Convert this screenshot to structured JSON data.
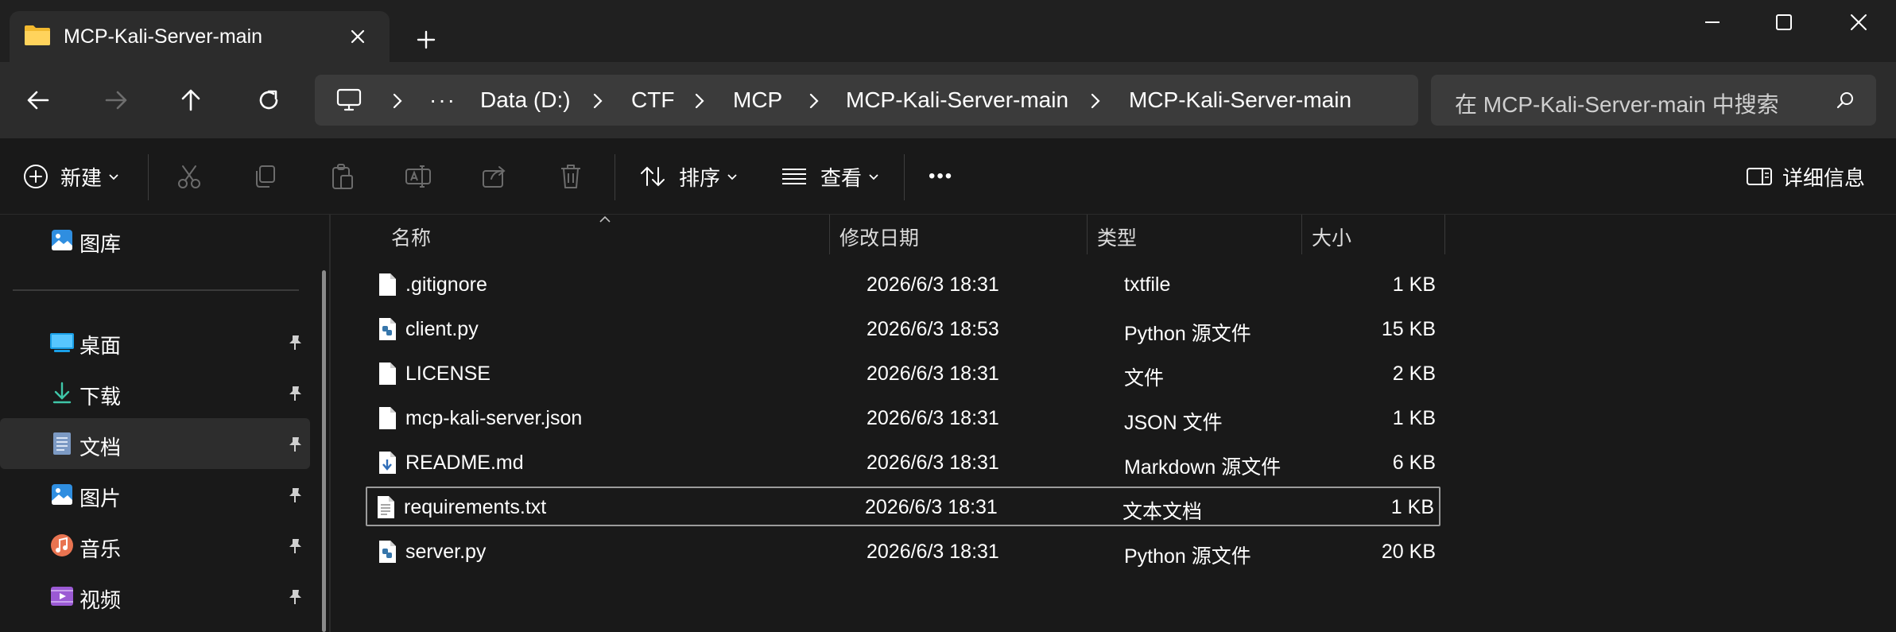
{
  "tab": {
    "title": "MCP-Kali-Server-main",
    "close_label": "×"
  },
  "address": {
    "overflow": "···",
    "crumbs": [
      "Data (D:)",
      "CTF",
      "MCP",
      "MCP-Kali-Server-main",
      "MCP-Kali-Server-main"
    ]
  },
  "search": {
    "placeholder": "在 MCP-Kali-Server-main 中搜索"
  },
  "toolbar": {
    "new_label": "新建",
    "sort_label": "排序",
    "view_label": "查看",
    "more_label": "•••",
    "details_label": "详细信息"
  },
  "sidebar": {
    "items": [
      {
        "label": "图库",
        "icon": "gallery-icon"
      },
      {
        "label": "桌面",
        "icon": "desktop-icon",
        "pinned": true
      },
      {
        "label": "下载",
        "icon": "download-icon",
        "pinned": true
      },
      {
        "label": "文档",
        "icon": "document-icon",
        "pinned": true,
        "active": true
      },
      {
        "label": "图片",
        "icon": "pictures-icon",
        "pinned": true
      },
      {
        "label": "音乐",
        "icon": "music-icon",
        "pinned": true
      },
      {
        "label": "视频",
        "icon": "video-icon",
        "pinned": true
      }
    ]
  },
  "columns": {
    "name": "名称",
    "modified": "修改日期",
    "type": "类型",
    "size": "大小"
  },
  "files": [
    {
      "name": ".gitignore",
      "modified": "2026/6/3 18:31",
      "type": "txtfile",
      "size": "1 KB",
      "icon": "blank-file-icon"
    },
    {
      "name": "client.py",
      "modified": "2026/6/3 18:53",
      "type": "Python 源文件",
      "size": "15 KB",
      "icon": "python-file-icon"
    },
    {
      "name": "LICENSE",
      "modified": "2026/6/3 18:31",
      "type": "文件",
      "size": "2 KB",
      "icon": "blank-file-icon"
    },
    {
      "name": "mcp-kali-server.json",
      "modified": "2026/6/3 18:31",
      "type": "JSON 文件",
      "size": "1 KB",
      "icon": "blank-file-icon"
    },
    {
      "name": "README.md",
      "modified": "2026/6/3 18:31",
      "type": "Markdown 源文件",
      "size": "6 KB",
      "icon": "markdown-file-icon"
    },
    {
      "name": "requirements.txt",
      "modified": "2026/6/3 18:31",
      "type": "文本文档",
      "size": "1 KB",
      "icon": "text-file-icon",
      "selected": true
    },
    {
      "name": "server.py",
      "modified": "2026/6/3 18:31",
      "type": "Python 源文件",
      "size": "20 KB",
      "icon": "python-file-icon"
    }
  ]
}
